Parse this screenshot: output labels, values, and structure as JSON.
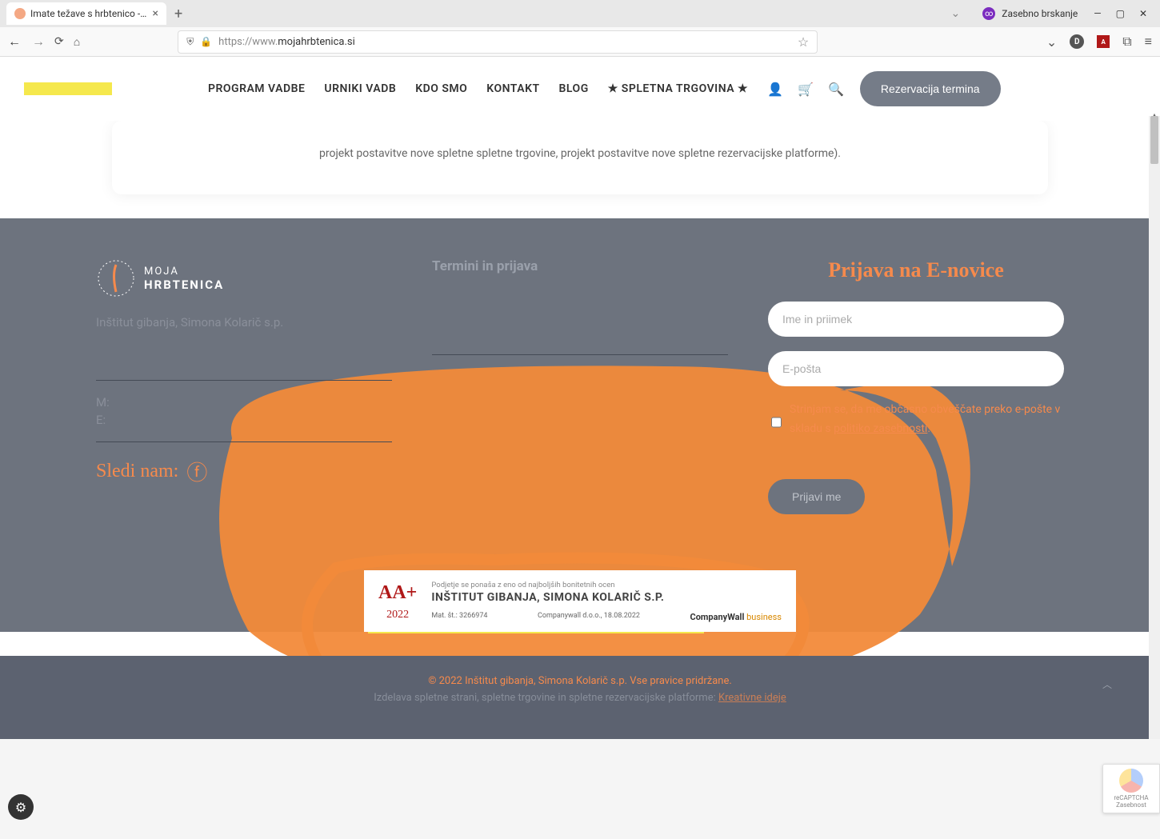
{
  "browser": {
    "tab_title": "Imate težave s hrbtenico - Moja",
    "private_browsing": "Zasebno brskanje",
    "url_prefix": "https://www.",
    "url_domain": "mojahrbtenica.si"
  },
  "nav": {
    "items": [
      "PROGRAM VADBE",
      "URNIKI VADB",
      "KDO SMO",
      "KONTAKT",
      "BLOG",
      "★ SPLETNA TRGOVINA ★"
    ],
    "cta": "Rezervacija termina"
  },
  "card": {
    "text": "projekt postavitve nove spletne spletne trgovine, projekt postavitve nove spletne rezervacijske platforme)."
  },
  "footer": {
    "logo_line1": "MOJA",
    "logo_line2": "HRBTENICA",
    "company": "Inštitut gibanja, Simona Kolarič s.p.",
    "m_label": "M:",
    "e_label": "E:",
    "follow": "Sledi nam:",
    "col2_heading": "Termini in prijava",
    "newsletter_heading": "Prijava na E-novice",
    "name_placeholder": "Ime in priimek",
    "email_placeholder": "E-pošta",
    "consent": "Strinjam se, da me občasno obveščate preko e-pošte v skladu s",
    "privacy": "politiko zasebnosti",
    "submit": "Prijavi me"
  },
  "cert": {
    "aa": "AA+",
    "year": "2022",
    "tagline": "Podjetje se ponaša z eno od najboljših bonitetnih ocen",
    "company": "INŠTITUT GIBANJA, SIMONA KOLARIČ S.P.",
    "mat_label": "Mat. št.:",
    "mat_value": "3266974",
    "issuer": "Companywall d.o.o.,",
    "date": "18.08.2022",
    "cw1": "Company",
    "cw2": "Wall",
    "cw3": "business"
  },
  "bottom": {
    "copyright": "© 2022 Inštitut gibanja, Simona Kolarič s.p. Vse pravice pridržane.",
    "credit": "Izdelava spletne strani, spletne trgovine in spletne rezervacijske platforme:",
    "credit_link": "Kreativne ideje"
  },
  "recaptcha": {
    "label": "reCAPTCHA",
    "privacy": "Zasebnost"
  }
}
